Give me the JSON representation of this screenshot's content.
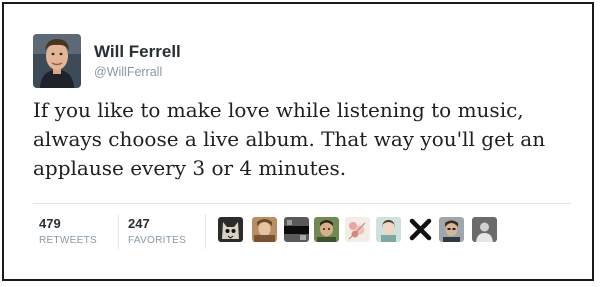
{
  "tweet": {
    "display_name": "Will Ferrell",
    "handle": "@WillFerrall",
    "text_lines": [
      "If you like to make love while listening to music,",
      "always choose a live album. That way you'll get an",
      "applause every 3 or 4 minutes."
    ],
    "stats": {
      "retweets_count": "479",
      "retweets_label": "RETWEETS",
      "favorites_count": "247",
      "favorites_label": "FAVORITES"
    },
    "favoriter_avatars": [
      "avatar-cat-mask",
      "avatar-sepia-portrait",
      "avatar-dark-bar",
      "avatar-green-face",
      "avatar-pink-flowers",
      "avatar-girl-teal",
      "avatar-black-x",
      "avatar-man-face",
      "avatar-gray-person"
    ]
  },
  "colors": {
    "name": "#292f33",
    "muted": "#8899a6",
    "border": "#1a1a1a"
  }
}
